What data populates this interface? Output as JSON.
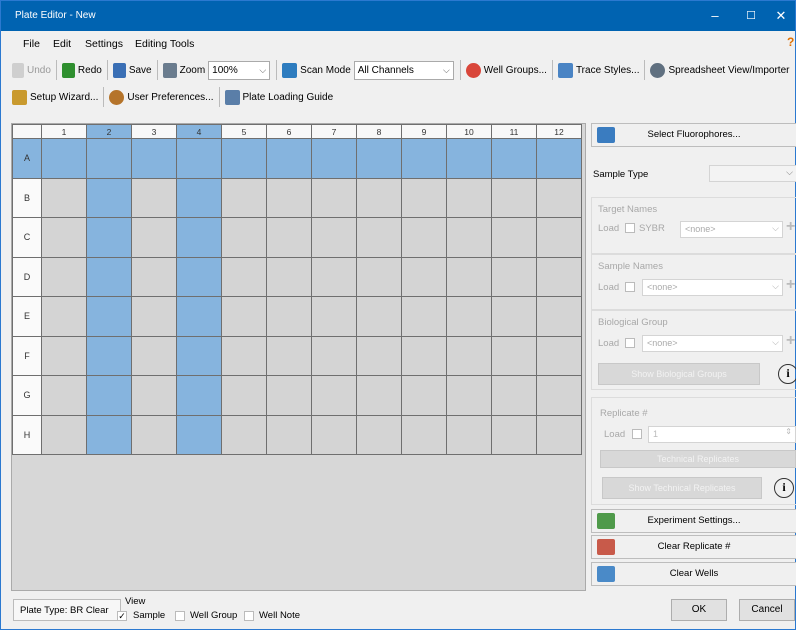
{
  "window": {
    "title": "Plate Editor - New",
    "min": "‒",
    "max": "☐",
    "close": "✕"
  },
  "menu": [
    "File",
    "Edit",
    "Settings",
    "Editing Tools"
  ],
  "toolbar1": {
    "undo": "Undo",
    "redo": "Redo",
    "save": "Save",
    "zoom": "Zoom",
    "zoom_value": "100%",
    "scan_mode": "Scan Mode",
    "scan_value": "All Channels",
    "well_groups": "Well Groups...",
    "trace_styles": "Trace Styles...",
    "spreadsheet": "Spreadsheet View/Importer"
  },
  "toolbar2": {
    "setup_wizard": "Setup Wizard...",
    "user_prefs": "User Preferences...",
    "loading_guide": "Plate Loading Guide"
  },
  "plate": {
    "columns": [
      "1",
      "2",
      "3",
      "4",
      "5",
      "6",
      "7",
      "8",
      "9",
      "10",
      "11",
      "12"
    ],
    "rows": [
      "A",
      "B",
      "C",
      "D",
      "E",
      "F",
      "G",
      "H"
    ],
    "selected_columns": [
      2,
      4
    ],
    "selected_row": "A"
  },
  "right": {
    "select_fluorophores": "Select Fluorophores...",
    "sample_type_label": "Sample Type",
    "target_names": "Target Names",
    "load": "Load",
    "sybr": "SYBR",
    "none": "<none>",
    "sample_names": "Sample Names",
    "biological_group": "Biological Group",
    "show_bio_groups": "Show Biological Groups",
    "replicate": "Replicate #",
    "replicate_value": "1",
    "technical_replicates": "Technical Replicates",
    "show_tech_replicates": "Show Technical Replicates",
    "experiment_settings": "Experiment Settings...",
    "clear_replicate": "Clear Replicate #",
    "clear_wells": "Clear Wells"
  },
  "bottom": {
    "plate_type": "Plate Type: BR Clear",
    "view": "View",
    "sample": "Sample",
    "well_group": "Well Group",
    "well_note": "Well Note",
    "ok": "OK",
    "cancel": "Cancel"
  },
  "colors": {
    "title_bar": "#0063b1",
    "selection": "#86b4de",
    "well": "#d4d4d4"
  }
}
